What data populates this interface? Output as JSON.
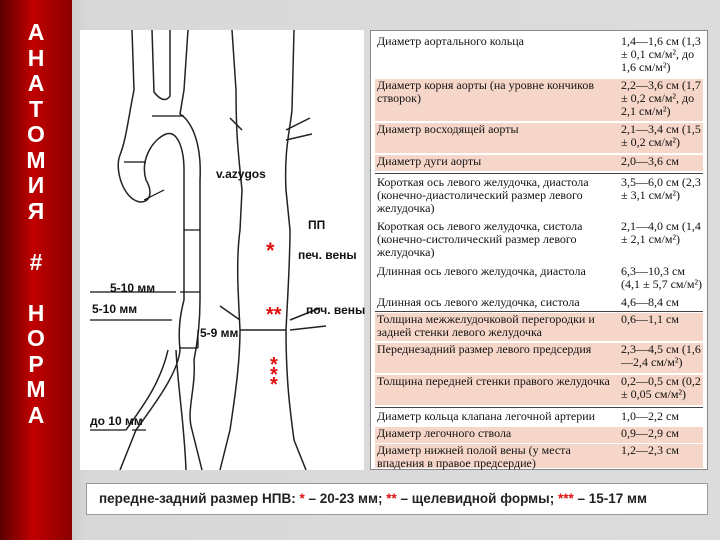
{
  "sidebar": {
    "letters": [
      "А",
      "Н",
      "А",
      "Т",
      "О",
      "М",
      "И",
      "Я",
      "",
      "#",
      "",
      "Н",
      "О",
      "Р",
      "М",
      "А"
    ]
  },
  "diagram": {
    "labels": {
      "azygos": "v.azygos",
      "pp": "ПП",
      "hep_veins": "печ. вены",
      "renal_veins": "поч. вены",
      "aorta_5_10_a": "5-10 мм",
      "aorta_5_10_b": "5-10 мм",
      "aorta_5_9": "5-9 мм",
      "aorta_to_10": "до 10 мм"
    },
    "stars": {
      "one": "*",
      "two": "**",
      "three": "***"
    }
  },
  "table": {
    "rows": [
      {
        "name": "Диаметр аортального кольца",
        "value": "1,4—1,6 см (1,3 ± 0,1 см/м², до 1,6 см/м²)",
        "hl": false
      },
      {
        "name": "Диаметр корня аорты (на уровне кончиков створок)",
        "value": "2,2—3,6 см (1,7 ± 0,2 см/м², до 2,1 см/м²)",
        "hl": true
      },
      {
        "name": "Диаметр восходящей аорты",
        "value": "2,1—3,4 см (1,5 ± 0,2 см/м²)",
        "hl": true
      },
      {
        "name": "Диаметр дуги аорты",
        "value": "2,0—3,6 см",
        "hl": true
      },
      {
        "name": "Короткая ось левого желудочка, диастола (конечно-диастолический размер левого желудочка)",
        "value": "3,5—6,0 см (2,3 ± 3,1 см/м²)",
        "hl": false
      },
      {
        "name": "Короткая ось левого желудочка, систола (конечно-систолический размер левого желудочка)",
        "value": "2,1—4,0 см (1,4 ± 2,1 см/м²)",
        "hl": false
      },
      {
        "name": "Длинная ось левого желудочка, диастола",
        "value": "6,3—10,3 см (4,1 ± 5,7 см/м²)",
        "hl": false
      },
      {
        "name": "Длинная ось левого желудочка, систола",
        "value": "4,6—8,4 см",
        "hl": false
      },
      {
        "name": "Толщина межжелудочковой перегородки и задней стенки левого желудочка",
        "value": "0,6—1,1 см",
        "hl": true
      },
      {
        "name": "Переднезадний размер левого предсердия",
        "value": "2,3—4,5 см (1,6—2,4 см/м²)",
        "hl": true
      },
      {
        "name": "Толщина передней стенки правого желудочка",
        "value": "0,2—0,5 см (0,2 ± 0,05 см/м²)",
        "hl": true
      },
      {
        "name": "Диаметр кольца клапана легочной артерии",
        "value": "1,0—2,2 см",
        "hl": false
      },
      {
        "name": "Диаметр легочного ствола",
        "value": "0,9—2,9 см",
        "hl": true
      },
      {
        "name": "Диаметр нижней полой вены (у места впадения в правое предсердие)",
        "value": "1,2—2,3 см",
        "hl": true
      }
    ]
  },
  "footer": {
    "text_a": "передне-задний размер НПВ: ",
    "star1": "*",
    "text_b": " – 20-23 мм; ",
    "star2": "**",
    "text_c": " – щелевидной формы; ",
    "star3": "***",
    "text_d": " – 15-17 мм"
  }
}
